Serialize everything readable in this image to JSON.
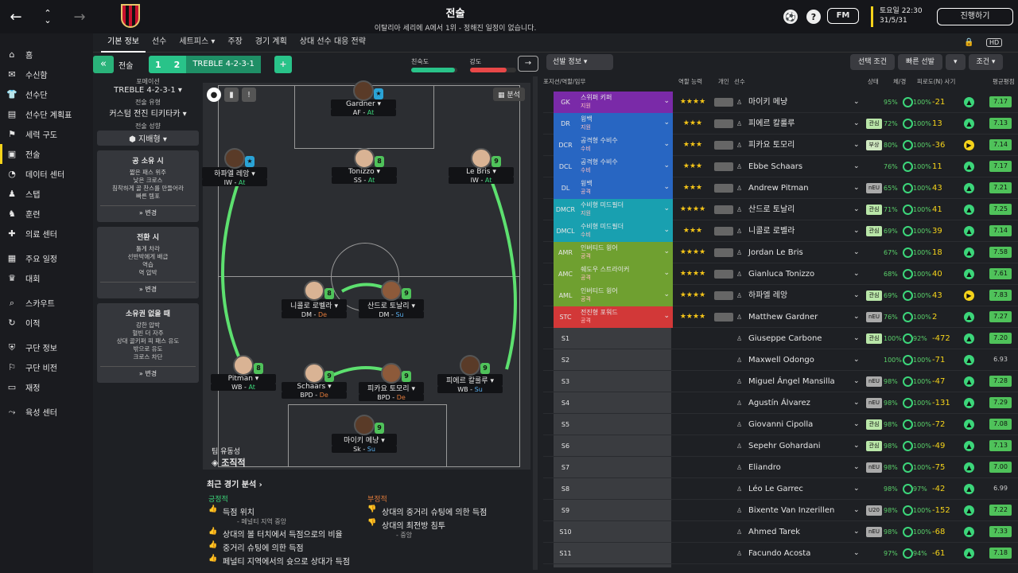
{
  "header": {
    "title": "전술",
    "subtitle": "이탈리아 세리에 A에서 1위 - 정해진 일정이 없습니다.",
    "date_line1": "토요일 22:30",
    "date_line2": "31/5/31",
    "fm_label": "FM",
    "continue_label": "진행하기"
  },
  "sidebar": {
    "items": [
      {
        "label": "홈",
        "icon": "home-icon"
      },
      {
        "label": "수신함",
        "icon": "inbox-icon"
      },
      {
        "label": "선수단",
        "icon": "shirt-icon"
      },
      {
        "label": "선수단 계획표",
        "icon": "clipboard-icon"
      },
      {
        "label": "세력 구도",
        "icon": "hierarchy-icon"
      },
      {
        "label": "전술",
        "icon": "tactics-icon"
      },
      {
        "label": "데이터 센터",
        "icon": "data-icon"
      },
      {
        "label": "스탭",
        "icon": "staff-icon"
      },
      {
        "label": "훈련",
        "icon": "training-icon"
      },
      {
        "label": "의료 센터",
        "icon": "medical-icon"
      },
      {
        "label": "주요 일정",
        "icon": "calendar-icon"
      },
      {
        "label": "대회",
        "icon": "trophy-icon"
      },
      {
        "label": "스카우트",
        "icon": "scout-icon"
      },
      {
        "label": "이적",
        "icon": "transfer-icon"
      },
      {
        "label": "구단 정보",
        "icon": "club-icon"
      },
      {
        "label": "구단 비전",
        "icon": "vision-icon"
      },
      {
        "label": "재정",
        "icon": "finance-icon"
      },
      {
        "label": "육성 센터",
        "icon": "youth-icon"
      }
    ]
  },
  "tabs": [
    "기본 정보",
    "선수",
    "세트피스 ▾",
    "주장",
    "경기 계획",
    "상대 선수 대응 전략"
  ],
  "tac_bar": {
    "label": "전술",
    "tab1": "1",
    "tab2": "2",
    "formation_name": "TREBLE 4-2-3-1",
    "plus": "+",
    "fam_label": "친숙도",
    "int_label": "강도",
    "sel_info": "선발 정보",
    "btn_cond": "선택 조건",
    "btn_quick": "빠른 선발",
    "btn_cond2": "조건"
  },
  "familiarity": 0.95,
  "intensity": 0.8,
  "left": {
    "formation_lbl": "포메이션",
    "formation": "TREBLE 4-2-3-1",
    "style_lbl": "전술 유형",
    "style": "커스텀 전진 티키타카",
    "mentality_lbl": "전술 성향",
    "mentality": "지배형",
    "possession": {
      "hd": "공 소유 시",
      "bd": "짧은 패스 위주\n낮은 크로스\n침착하게 골 찬스를 만들어라\n빠른 템포",
      "ft": "변경"
    },
    "transition": {
      "hd": "전환 시",
      "bd": "툴게 차라\n선반박에게 배급\n역습\n역 압박",
      "ft": "변경"
    },
    "outposs": {
      "hd": "소유권 없을 때",
      "bd": "강한 압박\n혈빈 더 자주\n상대 골키퍼 피 패스 유도\n밖으로 유도\n크로스 차단",
      "ft": "변경"
    }
  },
  "pitch": {
    "analysis": "분석",
    "fluidity_lbl": "팀 유동성",
    "fluidity": "조직적"
  },
  "players": [
    {
      "name": "Gardner",
      "role": "AF",
      "duty": "At",
      "badge": "★"
    },
    {
      "name": "하파엘 레앙",
      "role": "IW",
      "duty": "At",
      "badge": "★"
    },
    {
      "name": "Tonizzo",
      "role": "SS",
      "duty": "At",
      "badge": "8"
    },
    {
      "name": "Le Bris",
      "role": "IW",
      "duty": "At",
      "badge": "9"
    },
    {
      "name": "니콜로 로벨라",
      "role": "DM",
      "duty": "De",
      "badge": "8"
    },
    {
      "name": "산드로 토날리",
      "role": "DM",
      "duty": "Su",
      "badge": "9"
    },
    {
      "name": "Pitman",
      "role": "WB",
      "duty": "At",
      "badge": "8"
    },
    {
      "name": "Schaars",
      "role": "BPD",
      "duty": "De",
      "badge": "9"
    },
    {
      "name": "피카요 토모리",
      "role": "BPD",
      "duty": "De",
      "badge": "9"
    },
    {
      "name": "피에르 칼룰루",
      "role": "WB",
      "duty": "Su",
      "badge": "9"
    },
    {
      "name": "마이키 메냥",
      "role": "Sk",
      "duty": "Su",
      "badge": "9"
    }
  ],
  "recent": {
    "title": "최근 경기 분석 ›",
    "pos_lbl": "긍정적",
    "neg_lbl": "부정적",
    "pos": [
      {
        "t": "득점 위치",
        "s": "- 페널티 지역 중앙"
      },
      {
        "t": "상대의 볼 터치에서 득점으로의 비율",
        "s": ""
      },
      {
        "t": "중거리 슈팅에 의한 득점",
        "s": ""
      },
      {
        "t": "페널티 지역에서의 슛으로 상대가 득점",
        "s": ""
      }
    ],
    "neg": [
      {
        "t": "상대의 중거리 슈팅에 의한 득점",
        "s": ""
      },
      {
        "t": "상대의 최전방 침투",
        "s": "- 중앙"
      }
    ]
  },
  "list_hdr": {
    "pos": "포지션/역할/임무",
    "stars": "역할 능력",
    "pers": "개인",
    "player": "선수",
    "cond": "상태",
    "rate": "체/경",
    "fitness": "피로도(N) 사기",
    "avg": "평균평점"
  },
  "rows": [
    {
      "pos": "GK",
      "role": "스위퍼 키퍼",
      "duty": "지원",
      "color": "#7a2aa8",
      "stars": "★★★★",
      "name": "마이키 메냥",
      "tag": "",
      "pct": "95%",
      "cond": "100%",
      "diff": "-21",
      "st": "▲",
      "avg": "7.17"
    },
    {
      "pos": "DR",
      "role": "윙백",
      "duty": "지원",
      "color": "#2866c2",
      "stars": "★★★",
      "name": "피에르 칼룰루",
      "tag": "관심",
      "pct": "72%",
      "cond": "100%",
      "diff": "13",
      "st": "▲",
      "avg": "7.13"
    },
    {
      "pos": "DCR",
      "role": "공격형 수비수",
      "duty": "수비",
      "color": "#2866c2",
      "stars": "★★★",
      "name": "피카요 토모리",
      "tag": "부상",
      "pct": "80%",
      "cond": "100%",
      "diff": "-36",
      "st": "▶",
      "avg": "7.14"
    },
    {
      "pos": "DCL",
      "role": "공격형 수비수",
      "duty": "수비",
      "color": "#2866c2",
      "stars": "★★★",
      "name": "Ebbe Schaars",
      "tag": "",
      "pct": "76%",
      "cond": "100%",
      "diff": "11",
      "st": "▲",
      "avg": "7.17"
    },
    {
      "pos": "DL",
      "role": "윙백",
      "duty": "공격",
      "color": "#2866c2",
      "stars": "★★★",
      "name": "Andrew Pitman",
      "tag": "nEU",
      "pct": "65%",
      "cond": "100%",
      "diff": "43",
      "st": "▲",
      "avg": "7.21"
    },
    {
      "pos": "DMCR",
      "role": "수비형 미드필더",
      "duty": "지원",
      "color": "#19a0b0",
      "stars": "★★★★",
      "name": "산드로 토날리",
      "tag": "관심",
      "pct": "71%",
      "cond": "100%",
      "diff": "41",
      "st": "▲",
      "avg": "7.25"
    },
    {
      "pos": "DMCL",
      "role": "수비형 미드필더",
      "duty": "수비",
      "color": "#19a0b0",
      "stars": "★★★",
      "name": "니콜로 로벨라",
      "tag": "관심",
      "pct": "69%",
      "cond": "100%",
      "diff": "39",
      "st": "▲",
      "avg": "7.14"
    },
    {
      "pos": "AMR",
      "role": "인버티드 윙어",
      "duty": "공격",
      "color": "#6fa030",
      "stars": "★★★★",
      "name": "Jordan Le Bris",
      "tag": "",
      "pct": "67%",
      "cond": "100%",
      "diff": "18",
      "st": "▲",
      "avg": "7.58"
    },
    {
      "pos": "AMC",
      "role": "쉐도우 스트라이커",
      "duty": "공격",
      "color": "#6fa030",
      "stars": "★★★★",
      "name": "Gianluca Tonizzo",
      "tag": "",
      "pct": "68%",
      "cond": "100%",
      "diff": "40",
      "st": "▲",
      "avg": "7.61"
    },
    {
      "pos": "AML",
      "role": "인버티드 윙어",
      "duty": "공격",
      "color": "#6fa030",
      "stars": "★★★★",
      "name": "하파엘 레앙",
      "tag": "관심",
      "pct": "69%",
      "cond": "100%",
      "diff": "43",
      "st": "▶",
      "avg": "7.83"
    },
    {
      "pos": "STC",
      "role": "전진형 포워드",
      "duty": "공격",
      "color": "#d23838",
      "stars": "★★★★",
      "name": "Matthew Gardner",
      "tag": "nEU",
      "pct": "76%",
      "cond": "100%",
      "diff": "2",
      "st": "▲",
      "avg": "7.27"
    },
    {
      "pos": "S1",
      "role": "",
      "duty": "",
      "color": "",
      "stars": "",
      "name": "Giuseppe Carbone",
      "tag": "관심",
      "pct": "100%",
      "cond": "92%",
      "diff": "-472",
      "st": "▲",
      "avg": "7.20"
    },
    {
      "pos": "S2",
      "role": "",
      "duty": "",
      "color": "",
      "stars": "",
      "name": "Maxwell Odongo",
      "tag": "",
      "pct": "100%",
      "cond": "100%",
      "diff": "-71",
      "st": "▲",
      "avg": "6.93"
    },
    {
      "pos": "S3",
      "role": "",
      "duty": "",
      "color": "",
      "stars": "",
      "name": "Miguel Ángel Mansilla",
      "tag": "nEU",
      "pct": "98%",
      "cond": "100%",
      "diff": "-47",
      "st": "▲",
      "avg": "7.28"
    },
    {
      "pos": "S4",
      "role": "",
      "duty": "",
      "color": "",
      "stars": "",
      "name": "Agustín Álvarez",
      "tag": "nEU",
      "pct": "98%",
      "cond": "100%",
      "diff": "-131",
      "st": "▲",
      "avg": "7.29"
    },
    {
      "pos": "S5",
      "role": "",
      "duty": "",
      "color": "",
      "stars": "",
      "name": "Giovanni Cipolla",
      "tag": "관심",
      "pct": "98%",
      "cond": "100%",
      "diff": "-72",
      "st": "▲",
      "avg": "7.08"
    },
    {
      "pos": "S6",
      "role": "",
      "duty": "",
      "color": "",
      "stars": "",
      "name": "Sepehr Gohardani",
      "tag": "관심",
      "pct": "98%",
      "cond": "100%",
      "diff": "-49",
      "st": "▲",
      "avg": "7.13"
    },
    {
      "pos": "S7",
      "role": "",
      "duty": "",
      "color": "",
      "stars": "",
      "name": "Eliandro",
      "tag": "nEU",
      "pct": "98%",
      "cond": "100%",
      "diff": "-75",
      "st": "▲",
      "avg": "7.00"
    },
    {
      "pos": "S8",
      "role": "",
      "duty": "",
      "color": "",
      "stars": "",
      "name": "Léo Le Garrec",
      "tag": "",
      "pct": "98%",
      "cond": "97%",
      "diff": "-42",
      "st": "▲",
      "avg": "6.99"
    },
    {
      "pos": "S9",
      "role": "",
      "duty": "",
      "color": "",
      "stars": "",
      "name": "Bixente Van Inzerillen",
      "tag": "U20",
      "pct": "98%",
      "cond": "100%",
      "diff": "-152",
      "st": "▲",
      "avg": "7.22"
    },
    {
      "pos": "S10",
      "role": "",
      "duty": "",
      "color": "",
      "stars": "",
      "name": "Ahmed Tarek",
      "tag": "nEU",
      "pct": "98%",
      "cond": "100%",
      "diff": "-68",
      "st": "▲",
      "avg": "7.33"
    },
    {
      "pos": "S11",
      "role": "",
      "duty": "",
      "color": "",
      "stars": "",
      "name": "Facundo Acosta",
      "tag": "",
      "pct": "97%",
      "cond": "94%",
      "diff": "-61",
      "st": "▲",
      "avg": "7.18"
    }
  ]
}
